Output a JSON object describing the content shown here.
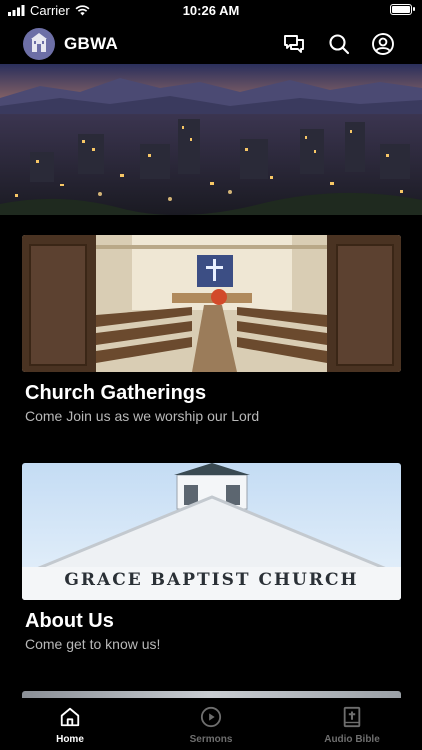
{
  "status_bar": {
    "carrier": "Carrier",
    "time": "10:26 AM"
  },
  "header": {
    "title": "GBWA",
    "icons": [
      "chat-icon",
      "search-icon",
      "account-icon"
    ]
  },
  "cards": [
    {
      "title": "Church Gatherings",
      "subtitle": "Come Join us as we worship our Lord"
    },
    {
      "title": "About Us",
      "subtitle": "Come get to know us!",
      "sign_text": "GRACE BAPTIST CHURCH"
    }
  ],
  "tabs": [
    {
      "label": "Home",
      "icon": "home-icon",
      "active": true
    },
    {
      "label": "Sermons",
      "icon": "play-circle-icon",
      "active": false
    },
    {
      "label": "Audio Bible",
      "icon": "bible-icon",
      "active": false
    }
  ],
  "colors": {
    "background": "#000000",
    "active_tab": "#ffffff",
    "inactive_tab": "#6e6e6e",
    "subtitle": "#b8b8b8"
  }
}
